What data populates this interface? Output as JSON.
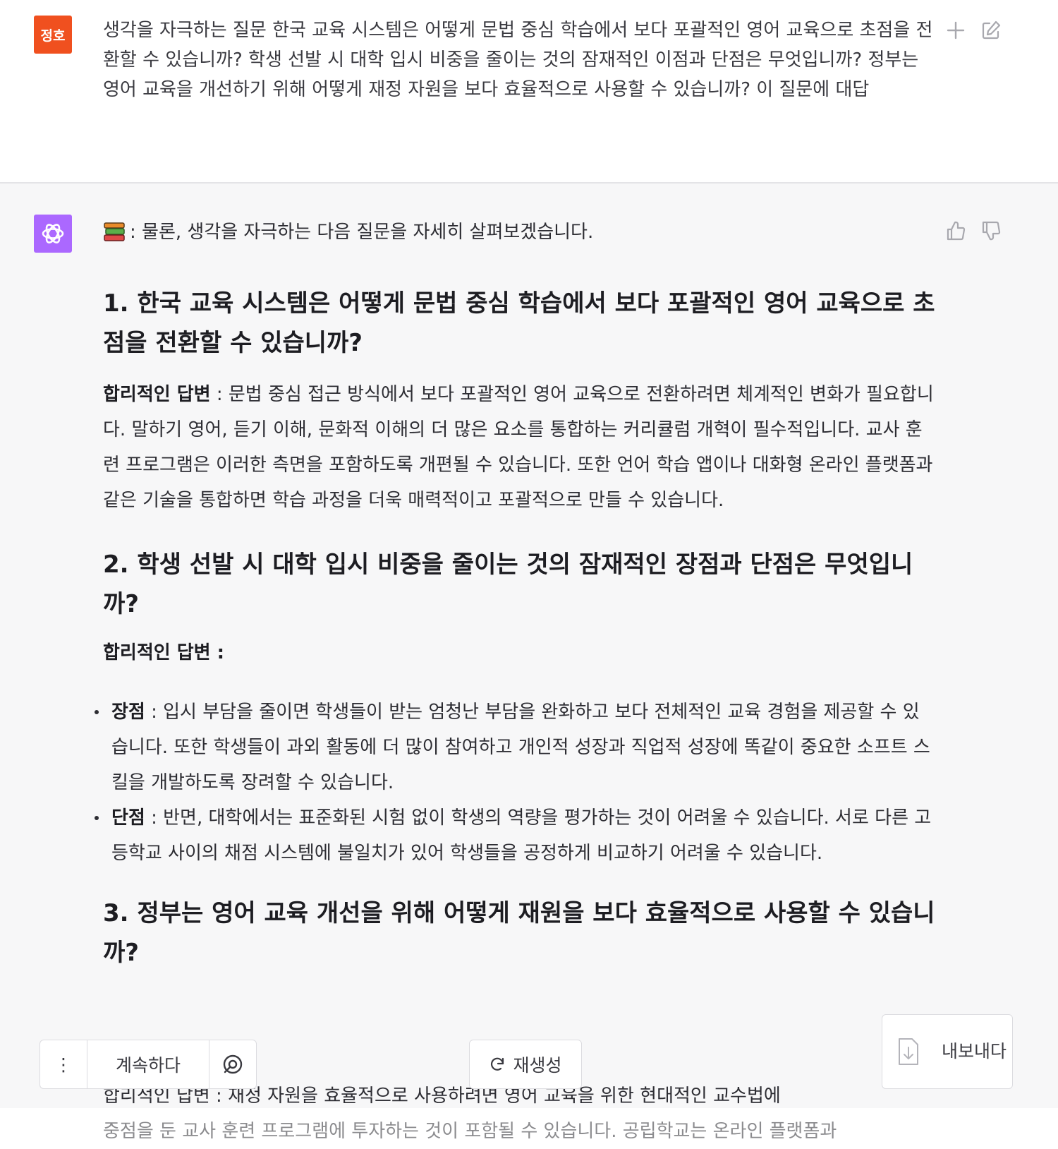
{
  "user": {
    "avatar_text": "정호",
    "message": "생각을 자극하는 질문 한국 교육 시스템은 어떻게 문법 중심 학습에서 보다 포괄적인 영어 교육으로 초점을 전환할 수 있습니까? 학생 선발 시 대학 입시 비중을 줄이는 것의 잠재적인 이점과 단점은 무엇입니까? 정부는 영어 교육을 개선하기 위해 어떻게 재정 자원을 보다 효율적으로 사용할 수 있습니까? 이 질문에 대답"
  },
  "assistant": {
    "intro": ": 물론, 생각을 자극하는 다음 질문을 자세히 살펴보겠습니다.",
    "q1": {
      "heading": "1. 한국 교육 시스템은 어떻게 문법 중심 학습에서 보다 포괄적인 영어 교육으로 초점을 전환할 수 있습니까?",
      "label": "합리적인 답변",
      "answer": " : 문법 중심 접근 방식에서 보다 포괄적인 영어 교육으로 전환하려면 체계적인 변화가 필요합니다. 말하기 영어, 듣기 이해, 문화적 이해의 더 많은 요소를 통합하는 커리큘럼 개혁이 필수적입니다. 교사 훈련 프로그램은 이러한 측면을 포함하도록 개편될 수 있습니다. 또한 언어 학습 앱이나 대화형 온라인 플랫폼과 같은 기술을 통합하면 학습 과정을 더욱 매력적이고 포괄적으로 만들 수 있습니다."
    },
    "q2": {
      "heading": "2. 학생 선발 시 대학 입시 비중을 줄이는 것의 잠재적인 장점과 단점은 무엇입니까?",
      "label": "합리적인 답변 :",
      "pros_label": "장점",
      "pros": " : 입시 부담을 줄이면 학생들이 받는 엄청난 부담을 완화하고 보다 전체적인 교육 경험을 제공할 수 있습니다. 또한 학생들이 과외 활동에 더 많이 참여하고 개인적 성장과 직업적 성장에 똑같이 중요한 소프트 스킬을 개발하도록 장려할 수 있습니다.",
      "cons_label": "단점",
      "cons": " : 반면, 대학에서는 표준화된 시험 없이 학생의 역량을 평가하는 것이 어려울 수 있습니다. 서로 다른 고등학교 사이의 채점 시스템에 불일치가 있어 학생들을 공정하게 비교하기 어려울 수 있습니다."
    },
    "q3": {
      "heading": "3. 정부는 영어 교육 개선을 위해 어떻게 재원을 보다 효율적으로 사용할 수 있습니까?",
      "partial_line_1": "합리적인 답변 : 재정 자원을 효율적으로 사용하려면 영어 교육을 위한 현대적인 교수법에",
      "partial_line_2": "중점을 둔 교사 훈련 프로그램에 투자하는 것이 포함될 수 있습니다. 공립학교는 온라인 플랫폼과"
    }
  },
  "toolbar": {
    "more": "⋮",
    "continue": "계속하다",
    "regenerate": "재생성",
    "export": "내보내다"
  }
}
